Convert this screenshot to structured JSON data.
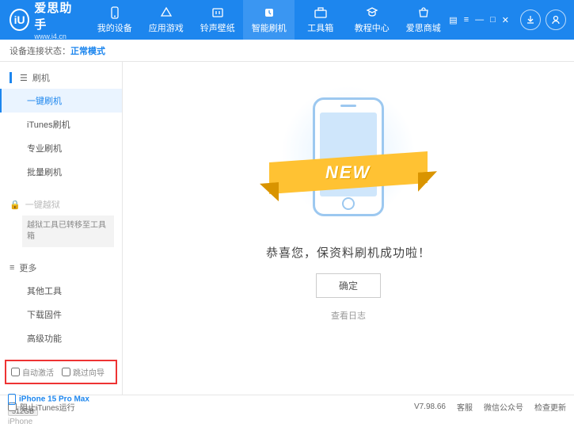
{
  "header": {
    "app_name": "爱思助手",
    "url": "www.i4.cn",
    "logo_letter": "iU"
  },
  "nav": [
    {
      "label": "我的设备"
    },
    {
      "label": "应用游戏"
    },
    {
      "label": "铃声壁纸"
    },
    {
      "label": "智能刷机"
    },
    {
      "label": "工具箱"
    },
    {
      "label": "教程中心"
    },
    {
      "label": "爱思商城"
    }
  ],
  "status": {
    "prefix": "设备连接状态：",
    "mode": "正常模式"
  },
  "sidebar": {
    "sec1": {
      "title": "刷机",
      "items": [
        "一键刷机",
        "iTunes刷机",
        "专业刷机",
        "批量刷机"
      ]
    },
    "sec2": {
      "title": "一键越狱",
      "notice": "越狱工具已转移至工具箱"
    },
    "sec3": {
      "title": "更多",
      "items": [
        "其他工具",
        "下载固件",
        "高级功能"
      ]
    },
    "checks": {
      "auto_activate": "自动激活",
      "skip_guide": "跳过向导"
    }
  },
  "device": {
    "name": "iPhone 15 Pro Max",
    "storage": "512GB",
    "type": "iPhone"
  },
  "main": {
    "ribbon": "NEW",
    "message": "恭喜您，保资料刷机成功啦！",
    "ok": "确定",
    "view_log": "查看日志"
  },
  "footer": {
    "block_itunes": "阻止iTunes运行",
    "version": "V7.98.66",
    "links": [
      "客服",
      "微信公众号",
      "检查更新"
    ]
  }
}
